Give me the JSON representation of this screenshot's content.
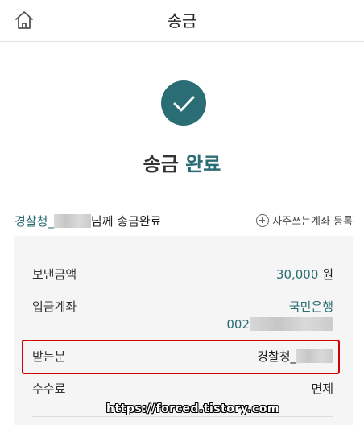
{
  "header": {
    "title": "송금",
    "home_icon": "home-icon"
  },
  "status": {
    "icon": "check-icon",
    "color": "#2a6d74",
    "title_prefix": "송금",
    "title_accent": "완료"
  },
  "recipient_line": {
    "name": "경찰청_",
    "suffix": "님께 송금완료"
  },
  "favorite_button": {
    "icon": "plus-circle-icon",
    "label": "자주쓰는계좌 등록"
  },
  "details": {
    "amount": {
      "label": "보낸금액",
      "value": "30,000",
      "unit": "원"
    },
    "account": {
      "label": "입금계좌",
      "bank": "국민은행",
      "number_prefix": "002"
    },
    "receiver": {
      "label": "받는분",
      "value": "경찰청_"
    },
    "fee": {
      "label": "수수료",
      "value": "면제"
    }
  },
  "watermark": "https://forced.tistory.com",
  "colors": {
    "accent": "#2a6d74",
    "highlight_border": "#d40000",
    "card_bg": "#f5f5f5"
  }
}
